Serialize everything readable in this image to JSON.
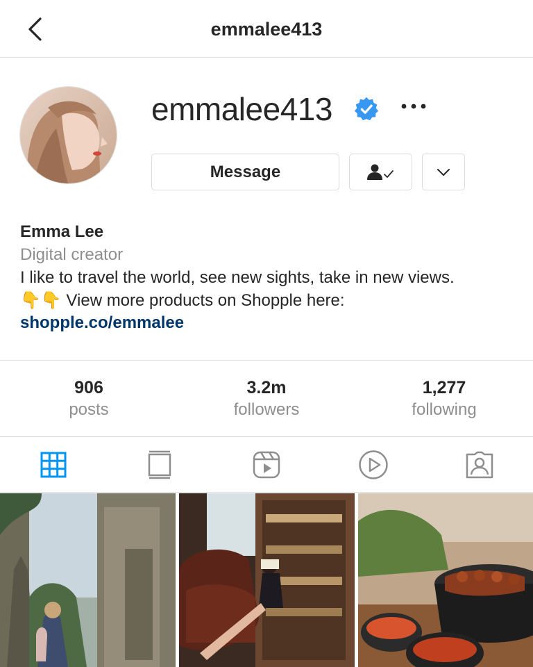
{
  "header": {
    "title": "emmalee413",
    "back_icon": "chevron-left-icon"
  },
  "profile": {
    "username": "emmalee413",
    "verified": true,
    "buttons": {
      "message": "Message"
    },
    "bio": {
      "name": "Emma Lee",
      "category": "Digital creator",
      "line1": "I like to travel the world, see new sights, take in new views.",
      "line2": "👇👇 View more products on Shopple here:",
      "link": "shopple.co/emmalee"
    }
  },
  "stats": [
    {
      "value": "906",
      "label": "posts"
    },
    {
      "value": "3.2m",
      "label": "followers"
    },
    {
      "value": "1,277",
      "label": "following"
    }
  ],
  "tabs": [
    "grid-icon",
    "guide-icon",
    "reels-icon",
    "video-icon",
    "tagged-icon"
  ],
  "colors": {
    "accent": "#0095f6",
    "link": "#00376b",
    "muted": "#8e8e8e",
    "border": "#dbdbdb",
    "verified": "#3897f0"
  }
}
